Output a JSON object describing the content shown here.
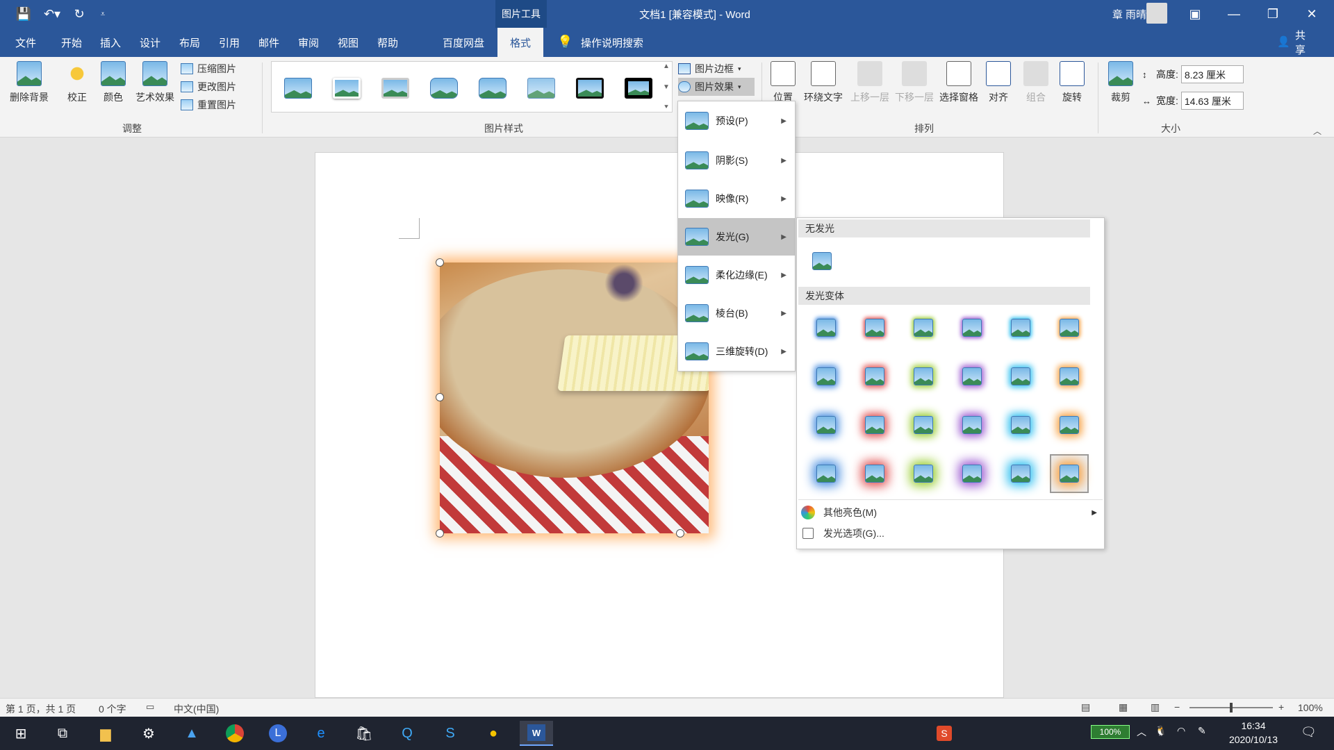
{
  "window": {
    "context_tab_group": "图片工具",
    "title": "文档1 [兼容模式] - Word",
    "user_name": "章 雨晴"
  },
  "tabs": [
    "文件",
    "开始",
    "插入",
    "设计",
    "布局",
    "引用",
    "邮件",
    "审阅",
    "视图",
    "帮助",
    "百度网盘",
    "格式"
  ],
  "active_tab": "格式",
  "tell_me": "操作说明搜索",
  "share": "共享",
  "ribbon": {
    "adjust": {
      "remove_bg": "删除背景",
      "corrections": "校正",
      "color": "颜色",
      "artistic": "艺术效果",
      "compress": "压缩图片",
      "change": "更改图片",
      "reset": "重置图片",
      "group_label": "调整"
    },
    "styles": {
      "group_label": "图片样式",
      "border": "图片边框",
      "effects": "图片效果"
    },
    "arrange": {
      "position": "位置",
      "wrap_text": "环绕文字",
      "bring_forward": "上移一层",
      "send_backward": "下移一层",
      "selection_pane": "选择窗格",
      "align": "对齐",
      "group": "组合",
      "rotate": "旋转",
      "group_label": "排列"
    },
    "size": {
      "crop": "裁剪",
      "height_label": "高度:",
      "height_value": "8.23 厘米",
      "width_label": "宽度:",
      "width_value": "14.63 厘米",
      "group_label": "大小"
    }
  },
  "effects_menu": [
    {
      "label": "预设(P)"
    },
    {
      "label": "阴影(S)"
    },
    {
      "label": "映像(R)"
    },
    {
      "label": "发光(G)"
    },
    {
      "label": "柔化边缘(E)"
    },
    {
      "label": "棱台(B)"
    },
    {
      "label": "三维旋转(D)"
    }
  ],
  "glow_submenu": {
    "no_glow": "无发光",
    "variations": "发光变体",
    "more_colors": "其他亮色(M)",
    "options": "发光选项(G)...",
    "colors": [
      "#4a8fe0",
      "#e05050",
      "#9acd32",
      "#9b59d0",
      "#30c0f0",
      "#f7a040"
    ]
  },
  "status": {
    "page": "第 1 页，共 1 页",
    "words": "0 个字",
    "language": "中文(中国)",
    "zoom": "100%"
  },
  "taskbar": {
    "battery": "100%",
    "time": "16:34",
    "date": "2020/10/13"
  }
}
